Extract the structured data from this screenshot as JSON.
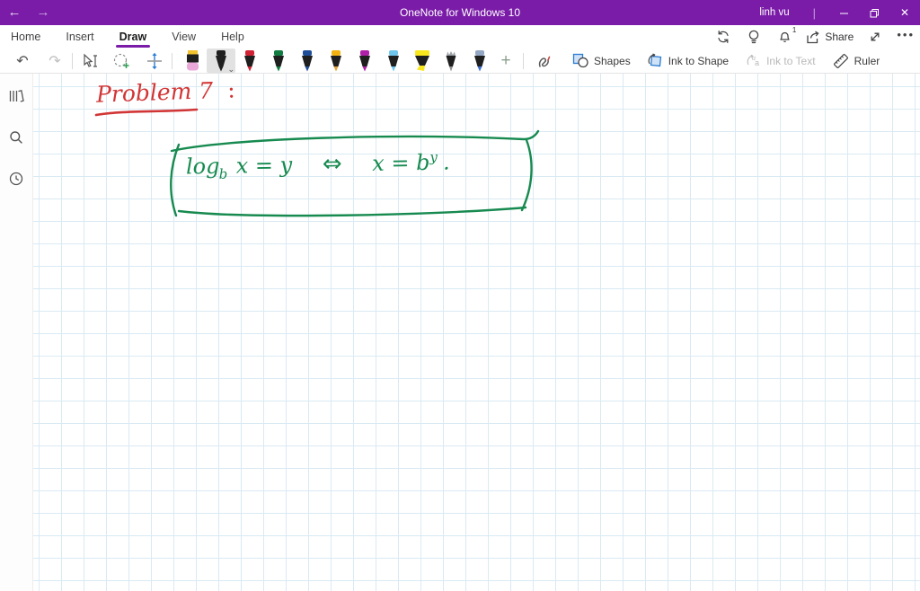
{
  "titlebar": {
    "back": "←",
    "forward": "→",
    "title": "OneNote for Windows 10",
    "user": "linh vu",
    "separator": "|",
    "close_glyph": "✕",
    "bg_color": "#7a1ca8"
  },
  "menu": {
    "items": [
      {
        "label": "Home"
      },
      {
        "label": "Insert"
      },
      {
        "label": "Draw"
      },
      {
        "label": "View"
      },
      {
        "label": "Help"
      }
    ],
    "active": "Draw",
    "right": {
      "notif_count": "1",
      "share_label": "Share",
      "ellipsis": "•••"
    }
  },
  "toolbar": {
    "undo": "↶",
    "redo": "↷",
    "add_pen": "+",
    "pens": [
      {
        "type": "eraser",
        "name": "eraser",
        "color": "#f2c230",
        "tip": "#e9a8d8"
      },
      {
        "type": "pen",
        "name": "black-pen",
        "color": "#1f1f1f",
        "tip": "#1f1f1f",
        "selected": true
      },
      {
        "type": "pen",
        "name": "red-pen",
        "color": "#cf2233",
        "tip": "#cf2233"
      },
      {
        "type": "pen",
        "name": "green-pen",
        "color": "#107c41",
        "tip": "#107c41"
      },
      {
        "type": "pen",
        "name": "blue-pen",
        "color": "#1f4e98",
        "tip": "#1f4e98"
      },
      {
        "type": "pen",
        "name": "yellow-pen",
        "color": "#f2b311",
        "tip": "#e0a33c"
      },
      {
        "type": "pen",
        "name": "magenta-pen",
        "color": "#b01fa8",
        "tip": "#b01fa8"
      },
      {
        "type": "pen",
        "name": "cyan-pen",
        "color": "#6ec6ec",
        "tip": "#6ec6ec"
      },
      {
        "type": "highlighter",
        "name": "yellow-highlighter",
        "color": "#f8e71c",
        "tip": "#f8e71c"
      },
      {
        "type": "pencil",
        "name": "pencil",
        "color": "#9aa0a6",
        "tip": "#8f8f8f"
      },
      {
        "type": "pen",
        "name": "galaxy-pen",
        "color": "#93a7c4",
        "tip": "#3c6fd6"
      }
    ],
    "labels": {
      "shapes": "Shapes",
      "ink_to_shape": "Ink to Shape",
      "ink_to_text": "Ink to Text",
      "ruler": "Ruler"
    }
  },
  "sidebar": {
    "items": [
      {
        "name": "notebooks"
      },
      {
        "name": "search"
      },
      {
        "name": "recent"
      }
    ]
  },
  "ink": {
    "problem_label": "Problem 7",
    "problem_colon": ":",
    "formula": {
      "func": "log",
      "base": "b",
      "lhs": "x = y",
      "iff": "⇔",
      "rhs": "x = b",
      "exp": "y",
      "period": "."
    },
    "red_color": "#d23535",
    "green_color": "#178a50"
  }
}
